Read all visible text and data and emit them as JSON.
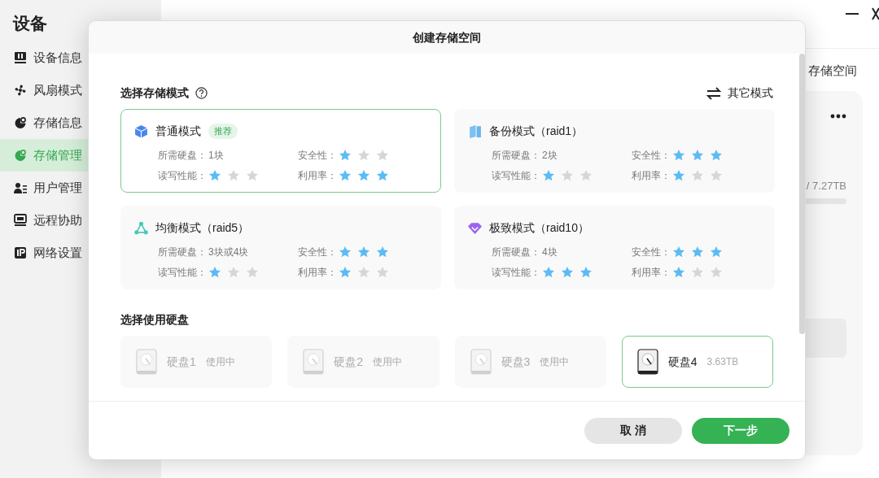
{
  "sidebar": {
    "title": "设备",
    "items": [
      {
        "label": "设备信息",
        "selected": false
      },
      {
        "label": "风扇模式",
        "selected": false
      },
      {
        "label": "存储信息",
        "selected": false
      },
      {
        "label": "存储管理",
        "selected": true
      },
      {
        "label": "用户管理",
        "selected": false
      },
      {
        "label": "远程协助",
        "selected": false
      },
      {
        "label": "网络设置",
        "selected": false
      }
    ]
  },
  "main": {
    "create_button": "存储空间",
    "capacity": "/ 7.27TB"
  },
  "dialog": {
    "title": "创建存储空间",
    "mode_heading": "选择存储模式",
    "other_modes": "其它模式",
    "modes": [
      {
        "name": "普通模式",
        "tag": "推荐",
        "selected": true,
        "specs": [
          {
            "kind": "text",
            "label": "所需硬盘：",
            "value": "1块"
          },
          {
            "kind": "stars",
            "label": "安全性：",
            "stars": 1
          },
          {
            "kind": "stars",
            "label": "读写性能：",
            "stars": 1
          },
          {
            "kind": "stars",
            "label": "利用率：",
            "stars": 3
          }
        ]
      },
      {
        "name": "备份模式（raid1）",
        "selected": false,
        "specs": [
          {
            "kind": "text",
            "label": "所需硬盘：",
            "value": "2块"
          },
          {
            "kind": "stars",
            "label": "安全性：",
            "stars": 3
          },
          {
            "kind": "stars",
            "label": "读写性能：",
            "stars": 1
          },
          {
            "kind": "stars",
            "label": "利用率：",
            "stars": 1
          }
        ]
      },
      {
        "name": "均衡模式（raid5）",
        "selected": false,
        "specs": [
          {
            "kind": "text",
            "label": "所需硬盘：",
            "value": "3块或4块"
          },
          {
            "kind": "stars",
            "label": "安全性：",
            "stars": 3
          },
          {
            "kind": "stars",
            "label": "读写性能：",
            "stars": 1
          },
          {
            "kind": "stars",
            "label": "利用率：",
            "stars": 1
          }
        ]
      },
      {
        "name": "极致模式（raid10）",
        "selected": false,
        "specs": [
          {
            "kind": "text",
            "label": "所需硬盘：",
            "value": "4块"
          },
          {
            "kind": "stars",
            "label": "安全性：",
            "stars": 3
          },
          {
            "kind": "stars",
            "label": "读写性能：",
            "stars": 3
          },
          {
            "kind": "stars",
            "label": "利用率：",
            "stars": 1
          }
        ]
      }
    ],
    "disk_heading": "选择使用硬盘",
    "disks": [
      {
        "name": "硬盘1",
        "info": "使用中",
        "disabled": true,
        "selected": false
      },
      {
        "name": "硬盘2",
        "info": "使用中",
        "disabled": true,
        "selected": false
      },
      {
        "name": "硬盘3",
        "info": "使用中",
        "disabled": true,
        "selected": false
      },
      {
        "name": "硬盘4",
        "info": "3.63TB",
        "disabled": false,
        "selected": true
      }
    ],
    "buttons": [
      {
        "label": "取 消",
        "kind": "secondary"
      },
      {
        "label": "下一步",
        "kind": "primary"
      }
    ]
  }
}
